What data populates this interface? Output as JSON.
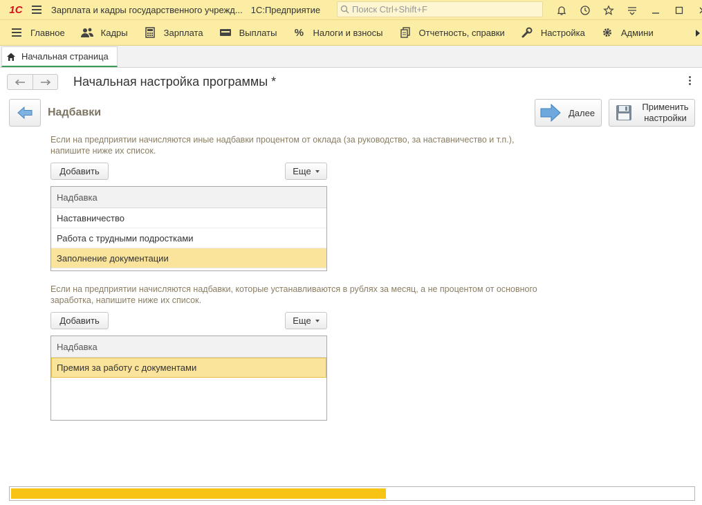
{
  "titlebar": {
    "logo": "1С",
    "title": "Зарплата и кадры государственного учрежд...",
    "app_name": "1С:Предприятие",
    "search_placeholder": "Поиск Ctrl+Shift+F",
    "icons": [
      "bell-icon",
      "history-icon",
      "star-icon",
      "menu-dropdown-icon",
      "minimize-icon",
      "maximize-icon",
      "close-icon"
    ]
  },
  "sections": [
    {
      "label": "Главное",
      "icon": "hamburger-icon"
    },
    {
      "label": "Кадры",
      "icon": "people-icon"
    },
    {
      "label": "Зарплата",
      "icon": "calculator-icon"
    },
    {
      "label": "Выплаты",
      "icon": "wallet-icon"
    },
    {
      "label": "Налоги и взносы",
      "icon": "percent-icon"
    },
    {
      "label": "Отчетность, справки",
      "icon": "documents-icon"
    },
    {
      "label": "Настройка",
      "icon": "wrench-icon"
    },
    {
      "label": "Админи",
      "icon": "gear-icon"
    }
  ],
  "tabs": [
    {
      "label": "Начальная страница",
      "icon": "home-icon"
    }
  ],
  "form": {
    "title": "Начальная настройка программы *"
  },
  "step": {
    "title": "Надбавки",
    "next_label": "Далее",
    "apply_label_line1": "Применить",
    "apply_label_line2": "настройки"
  },
  "percent_allowances": {
    "hint": "Если на предприятии начисляются иные надбавки процентом от оклада (за руководство, за наставничество и т.п.), напишите ниже их список.",
    "add_label": "Добавить",
    "more_label": "Еще",
    "column": "Надбавка",
    "rows": [
      "Наставничество",
      "Работа с трудными подростками",
      "Заполнение документации"
    ],
    "selected_index": 2
  },
  "fixed_allowances": {
    "hint": "Если на предприятии начисляются надбавки, которые устанавливаются в рублях за месяц, а не процентом от основного заработка, напишите ниже их список.",
    "add_label": "Добавить",
    "more_label": "Еще",
    "column": "Надбавка",
    "rows": [
      "Премия за работу с документами"
    ],
    "selected_index": 0
  },
  "progress": {
    "value": 0.55,
    "color": "#f7c415"
  },
  "colors": {
    "panel": "#fbeda4",
    "selection": "#fae39b",
    "accent_tab": "#3a9a58",
    "step_title": "#7d7461"
  }
}
